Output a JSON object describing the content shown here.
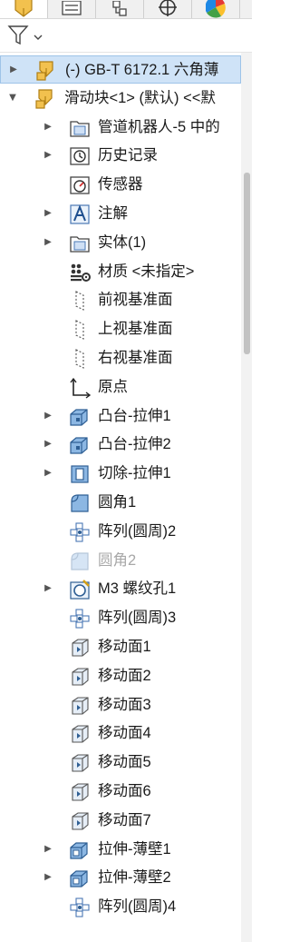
{
  "panel_tabs": [
    {
      "name": "feature-manager-tab",
      "icon": "part-icon",
      "active": true
    },
    {
      "name": "property-manager-tab",
      "icon": "property-list-icon"
    },
    {
      "name": "configuration-manager-tab",
      "icon": "configuration-icon"
    },
    {
      "name": "dimxpert-tab",
      "icon": "crosshair-icon"
    },
    {
      "name": "display-manager-tab",
      "icon": "color-wheel-icon"
    }
  ],
  "filter": {
    "icon": "filter-icon",
    "dropdown": "chevron-down-icon"
  },
  "tree": [
    {
      "label": "(-) GB-T 6172.1 六角薄",
      "icon": "part-icon",
      "expander": "right",
      "selected": true
    },
    {
      "label": "滑动块<1> (默认) <<默",
      "icon": "part-icon",
      "expander": "down"
    },
    {
      "label": "管道机器人-5 中的",
      "icon": "folder-icon",
      "expander": "right"
    },
    {
      "label": "历史记录",
      "icon": "history-icon",
      "expander": "right"
    },
    {
      "label": "传感器",
      "icon": "sensor-icon"
    },
    {
      "label": "注解",
      "icon": "annotation-icon",
      "expander": "right"
    },
    {
      "label": "实体(1)",
      "icon": "folder-icon",
      "expander": "right"
    },
    {
      "label": "材质 <未指定>",
      "icon": "material-icon"
    },
    {
      "label": "前视基准面",
      "icon": "plane-icon"
    },
    {
      "label": "上视基准面",
      "icon": "plane-icon"
    },
    {
      "label": "右视基准面",
      "icon": "plane-icon"
    },
    {
      "label": "原点",
      "icon": "origin-icon"
    },
    {
      "label": "凸台-拉伸1",
      "icon": "extrude-boss-icon",
      "expander": "right"
    },
    {
      "label": "凸台-拉伸2",
      "icon": "extrude-boss-icon",
      "expander": "right"
    },
    {
      "label": "切除-拉伸1",
      "icon": "extrude-cut-icon",
      "expander": "right"
    },
    {
      "label": "圆角1",
      "icon": "fillet-icon"
    },
    {
      "label": "阵列(圆周)2",
      "icon": "circular-pattern-icon"
    },
    {
      "label": "圆角2",
      "icon": "fillet-icon",
      "suppressed": true
    },
    {
      "label": "M3 螺纹孔1",
      "icon": "hole-wizard-icon",
      "expander": "right"
    },
    {
      "label": "阵列(圆周)3",
      "icon": "circular-pattern-icon"
    },
    {
      "label": "移动面1",
      "icon": "move-face-icon"
    },
    {
      "label": "移动面2",
      "icon": "move-face-icon"
    },
    {
      "label": "移动面3",
      "icon": "move-face-icon"
    },
    {
      "label": "移动面4",
      "icon": "move-face-icon"
    },
    {
      "label": "移动面5",
      "icon": "move-face-icon"
    },
    {
      "label": "移动面6",
      "icon": "move-face-icon"
    },
    {
      "label": "移动面7",
      "icon": "move-face-icon"
    },
    {
      "label": "拉伸-薄壁1",
      "icon": "extrude-thin-icon",
      "expander": "right"
    },
    {
      "label": "拉伸-薄壁2",
      "icon": "extrude-thin-icon",
      "expander": "right"
    },
    {
      "label": "阵列(圆周)4",
      "icon": "circular-pattern-icon"
    }
  ]
}
